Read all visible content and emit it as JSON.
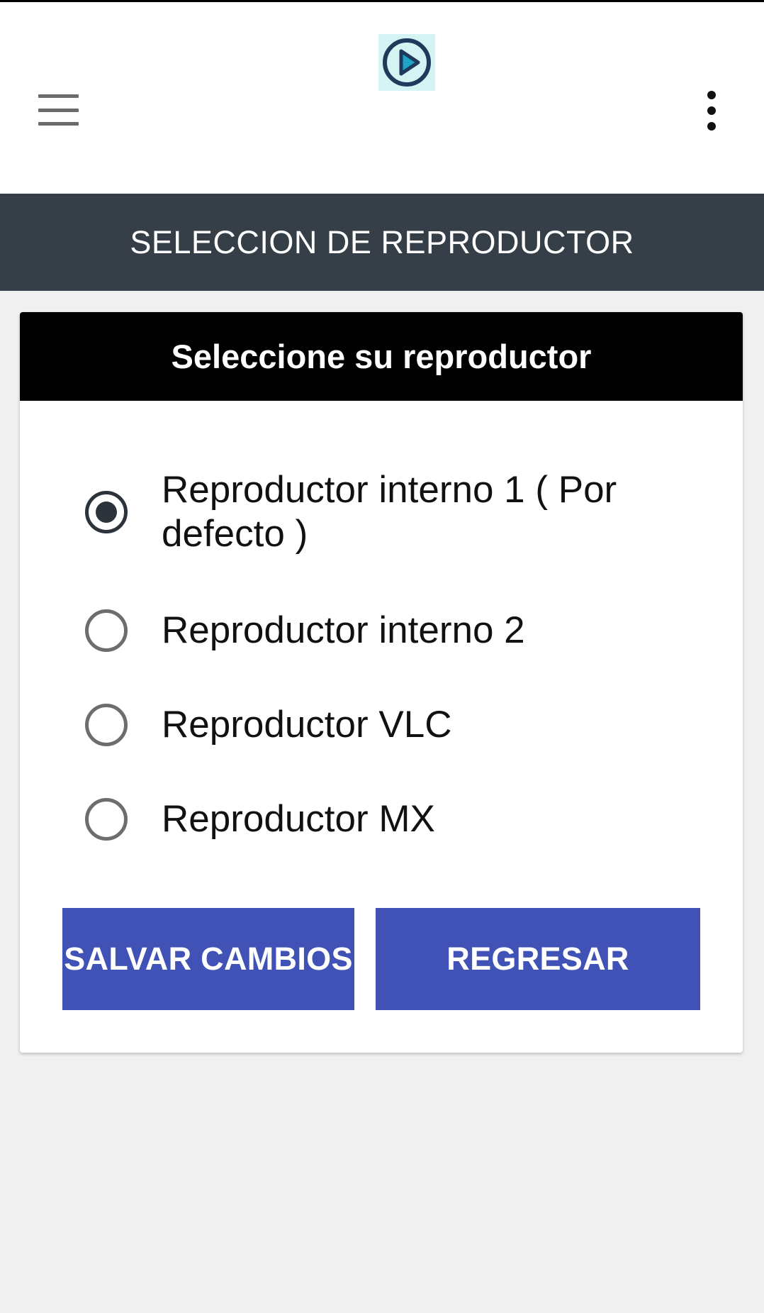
{
  "app": {
    "logo_icon": "play-circle-logo",
    "menu_icon": "hamburger-menu-icon",
    "overflow_icon": "more-vert-icon"
  },
  "section": {
    "title": "SELECCION DE REPRODUCTOR"
  },
  "card": {
    "header": "Seleccione su reproductor",
    "options": [
      {
        "label": "Reproductor interno 1 ( Por defecto )",
        "selected": true
      },
      {
        "label": "Reproductor interno 2",
        "selected": false
      },
      {
        "label": "Reproductor VLC",
        "selected": false
      },
      {
        "label": "Reproductor MX",
        "selected": false
      }
    ],
    "save_label": "SALVAR CAMBIOS",
    "back_label": "REGRESAR"
  },
  "colors": {
    "section_bar": "#363e47",
    "card_header": "#000000",
    "button": "#4052b5",
    "logo_bg": "#d6f3f3",
    "logo_ring": "#1f3a5a",
    "logo_play": "#1fa3c7"
  }
}
